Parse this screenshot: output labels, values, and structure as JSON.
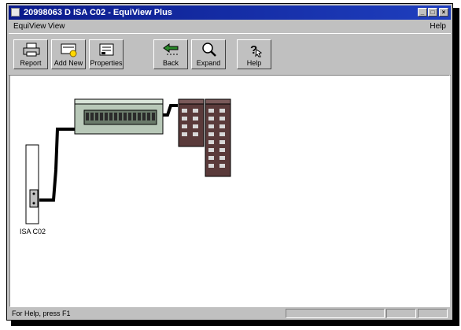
{
  "window": {
    "title": "20998063 D ISA C02 - EquiView Plus"
  },
  "title_buttons": {
    "minimize": "_",
    "maximize": "□",
    "close": "×"
  },
  "menu": {
    "items": [
      "EquiView",
      "View"
    ],
    "help": "Help"
  },
  "toolbar": {
    "buttons": [
      {
        "label": "Report",
        "icon": "printer-icon"
      },
      {
        "label": "Add New",
        "icon": "add-new-icon"
      },
      {
        "label": "Properties",
        "icon": "properties-icon"
      },
      {
        "label": "Back",
        "icon": "back-arrow-icon"
      },
      {
        "label": "Expand",
        "icon": "magnifier-icon"
      },
      {
        "label": "Help",
        "icon": "help-icon"
      }
    ]
  },
  "diagram": {
    "device_label": "ISA C02"
  },
  "status": {
    "text": "For Help, press F1"
  },
  "colors": {
    "titlebar": "#0a1a8a",
    "module": "#5a3a3a",
    "hub": "#b8c8b8"
  }
}
